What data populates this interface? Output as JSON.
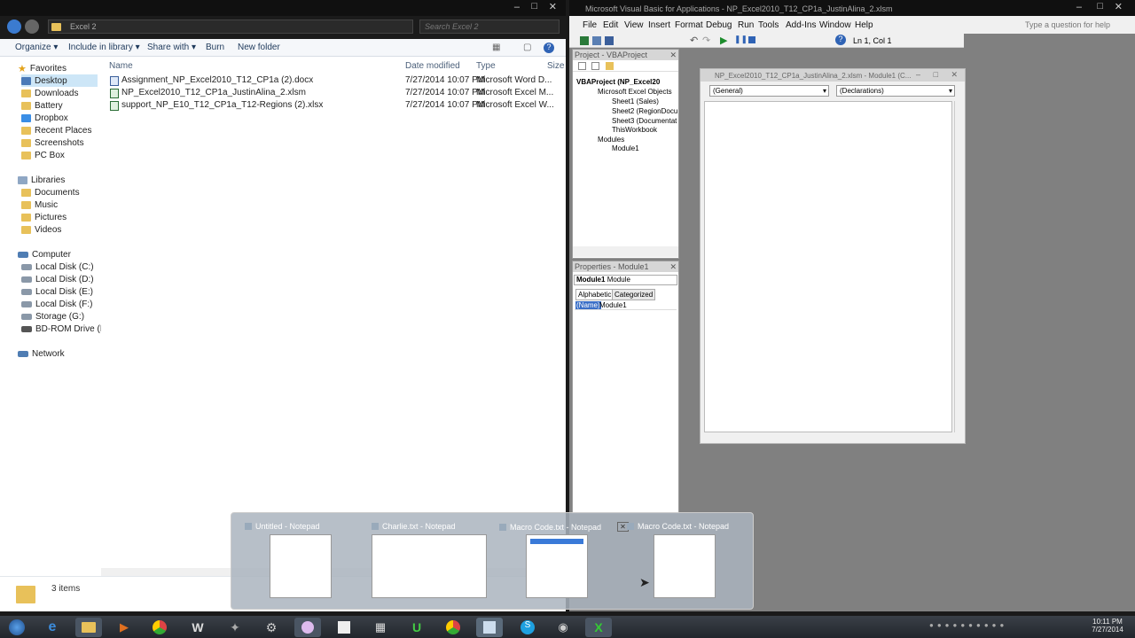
{
  "explorer": {
    "breadcrumb": "Excel 2",
    "search_placeholder": "Search Excel 2",
    "toolbar": {
      "organize": "Organize",
      "include": "Include in library",
      "share": "Share with",
      "burn": "Burn",
      "new_folder": "New folder"
    },
    "nav": {
      "favorites": "Favorites",
      "fav_items": [
        "Desktop",
        "Downloads",
        "Battery",
        "Dropbox",
        "Recent Places",
        "Screenshots",
        "PC Box"
      ],
      "libraries": "Libraries",
      "lib_items": [
        "Documents",
        "Music",
        "Pictures",
        "Videos"
      ],
      "computer": "Computer",
      "comp_items": [
        "Local Disk (C:)",
        "Local Disk (D:)",
        "Local Disk (E:)",
        "Local Disk (F:)",
        "Storage (G:)",
        "BD-ROM Drive (I:) N"
      ],
      "network": "Network"
    },
    "columns": {
      "name": "Name",
      "date": "Date modified",
      "type": "Type",
      "size": "Size"
    },
    "files": [
      {
        "name": "Assignment_NP_Excel2010_T12_CP1a (2).docx",
        "date": "7/27/2014 10:07 PM",
        "type": "Microsoft Word D...",
        "icon": "word-doc-icon"
      },
      {
        "name": "NP_Excel2010_T12_CP1a_JustinAlina_2.xlsm",
        "date": "7/27/2014 10:07 PM",
        "type": "Microsoft Excel M...",
        "icon": "excel-macro-icon"
      },
      {
        "name": "support_NP_E10_T12_CP1a_T12-Regions (2).xlsx",
        "date": "7/27/2014 10:07 PM",
        "type": "Microsoft Excel W...",
        "icon": "excel-icon"
      }
    ],
    "status": "3 items"
  },
  "vba": {
    "title": "Microsoft Visual Basic for Applications - NP_Excel2010_T12_CP1a_JustinAlina_2.xlsm",
    "menu": [
      "File",
      "Edit",
      "View",
      "Insert",
      "Format",
      "Debug",
      "Run",
      "Tools",
      "Add-Ins",
      "Window",
      "Help"
    ],
    "help_placeholder": "Type a question for help",
    "position": "Ln 1, Col 1",
    "project": {
      "title": "Project - VBAProject",
      "root": "VBAProject (NP_Excel20",
      "objects_folder": "Microsoft Excel Objects",
      "sheets": [
        "Sheet1 (Sales)",
        "Sheet2 (RegionDocu",
        "Sheet3 (Documentat",
        "ThisWorkbook"
      ],
      "modules_folder": "Modules",
      "module": "Module1"
    },
    "properties": {
      "title": "Properties - Module1",
      "object": "Module1",
      "object_type": "Module",
      "tab_alpha": "Alphabetic",
      "tab_cat": "Categorized",
      "prop_name": "(Name)",
      "prop_value": "Module1"
    },
    "code_window": {
      "title": "NP_Excel2010_T12_CP1a_JustinAlina_2.xlsm - Module1 (C...",
      "general": "(General)",
      "declarations": "(Declarations)"
    }
  },
  "thumbnails": [
    {
      "title": "Untitled - Notepad"
    },
    {
      "title": "Charlie.txt - Notepad"
    },
    {
      "title": "Macro Code.txt - Notepad"
    },
    {
      "title": "Macro Code.txt - Notepad"
    }
  ],
  "clock": {
    "time": "10:11 PM",
    "date": "7/27/2014"
  }
}
